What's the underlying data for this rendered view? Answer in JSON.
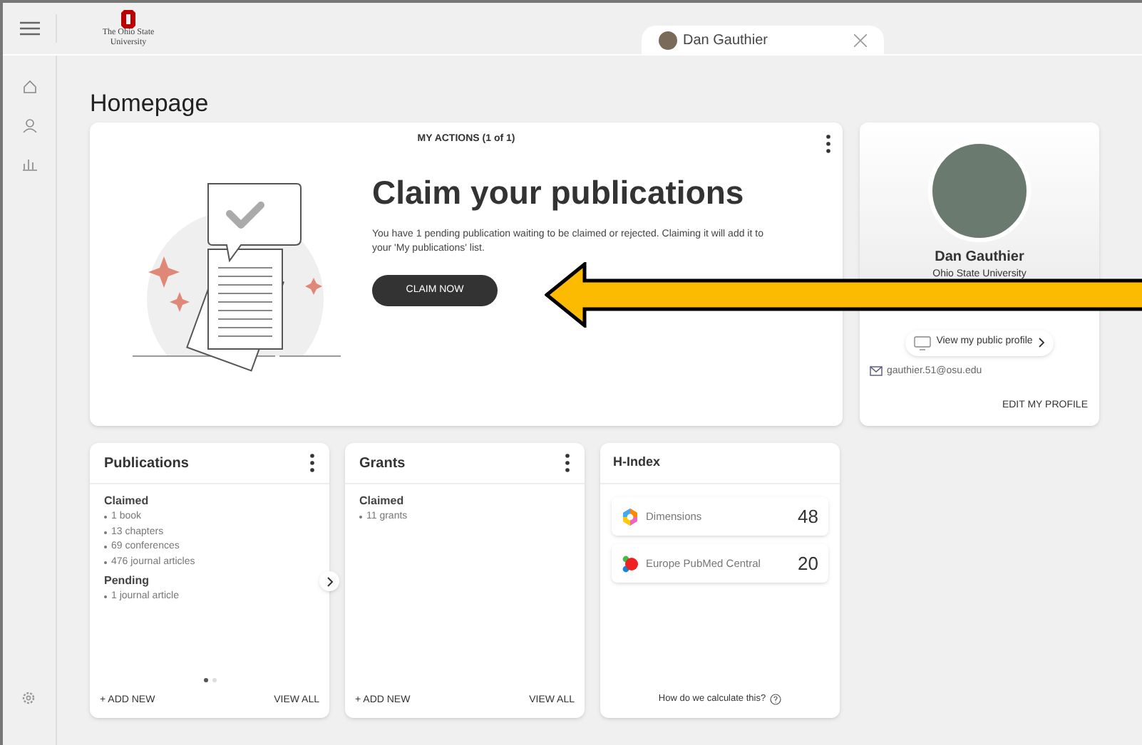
{
  "header": {
    "logo_line1": "The Ohio State",
    "logo_line2": "University",
    "tab": {
      "label": "Dan Gauthier",
      "selected": true
    }
  },
  "page_title": "Homepage",
  "actions": {
    "heading": "MY ACTIONS (1 of 1)",
    "title": "Claim your publications",
    "text": "You have 1 pending publication waiting to be claimed or rejected. Claiming it will add it to your 'My publications' list.",
    "button": "CLAIM NOW"
  },
  "profile": {
    "name": "Dan Gauthier",
    "affiliation": "Ohio State University",
    "public_link": "View my public profile",
    "email": "gauthier.51@osu.edu",
    "edit": "EDIT MY PROFILE"
  },
  "publications": {
    "title": "Publications",
    "groups": [
      {
        "label": "Claimed",
        "items": [
          "1 book",
          "13 chapters",
          "69 conferences",
          "476 journal articles"
        ]
      },
      {
        "label": "Pending",
        "items": [
          "1 journal article"
        ]
      }
    ],
    "dots": [
      {
        "selected": true
      },
      {
        "selected": false
      }
    ],
    "add": "+ ADD NEW",
    "view": "VIEW ALL"
  },
  "grants": {
    "title": "Grants",
    "groups": [
      {
        "label": "Claimed",
        "items": [
          "11 grants"
        ]
      }
    ],
    "add": "+ ADD NEW",
    "view": "VIEW ALL"
  },
  "hindex": {
    "title": "H-Index",
    "sources": [
      {
        "kind": "dimensions",
        "name": "Dimensions",
        "value": "48"
      },
      {
        "kind": "europepmc",
        "name": "Europe PubMed Central",
        "value": "20"
      }
    ],
    "help": "How do we calculate this?"
  }
}
